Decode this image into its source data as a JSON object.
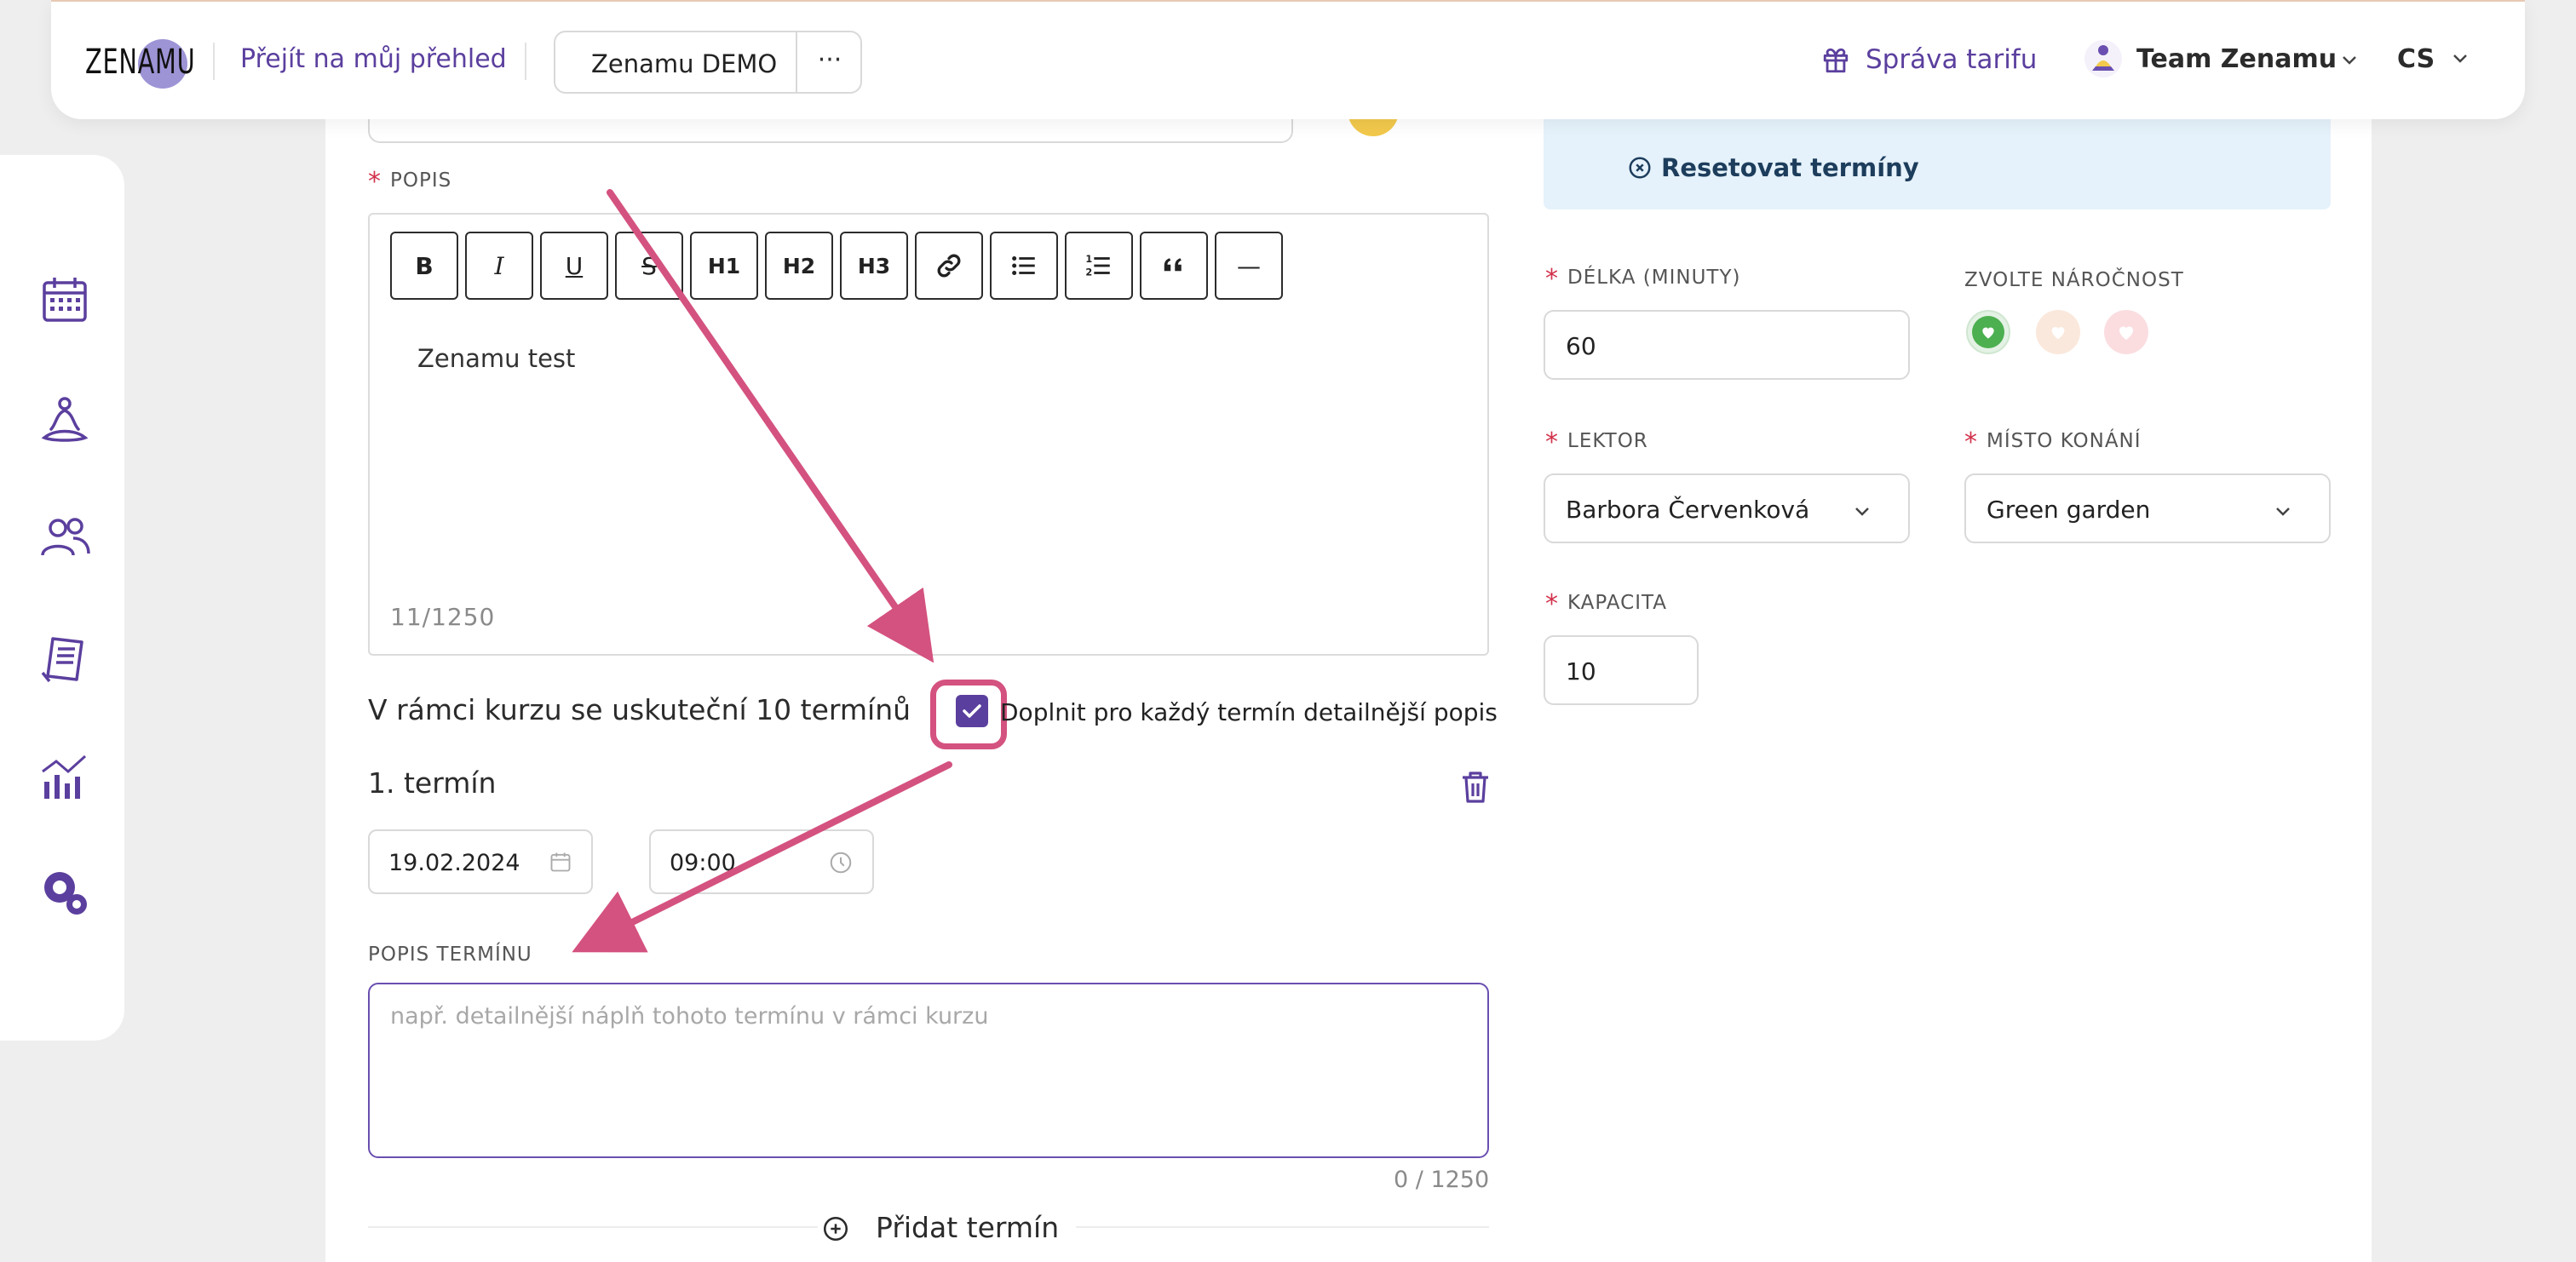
{
  "header": {
    "logo_text": "ZENAMU",
    "overview_link": "Přejít na můj přehled",
    "org_name": "Zenamu DEMO",
    "more_label": "···",
    "tariff_label": "Správa tarifu",
    "team_label": "Team Zenamu",
    "language": "CS"
  },
  "sidebar": {
    "items": [
      {
        "icon": "calendar-icon"
      },
      {
        "icon": "meditation-icon"
      },
      {
        "icon": "users-icon"
      },
      {
        "icon": "invoice-icon"
      },
      {
        "icon": "analytics-icon"
      },
      {
        "icon": "settings-icon"
      }
    ]
  },
  "form": {
    "description_label": "POPIS",
    "toolbar": [
      "B",
      "I",
      "U",
      "S",
      "H1",
      "H2",
      "H3",
      "link",
      "bulleted-list",
      "numbered-list",
      "quote",
      "—"
    ],
    "editor_text": "Zenamu test",
    "editor_count": "11/1250",
    "course_note": "V rámci kurzu se uskuteční 10 termínů",
    "detail_checkbox_label": "Doplnit pro každý termín detailnější popis",
    "detail_checkbox_checked": true,
    "term_title": "1. termín",
    "term_date": "19.02.2024",
    "term_time": "09:00",
    "term_desc_label": "POPIS TERMÍNU",
    "term_desc_placeholder": "např. detailnější náplň tohoto termínu v rámci kurzu",
    "term_desc_count": "0 / 1250",
    "add_term_label": "Přidat termín"
  },
  "right": {
    "reset_label": "Resetovat termíny",
    "duration_label": "DÉLKA (MINUTY)",
    "duration_value": "60",
    "difficulty_label": "ZVOLTE NÁROČNOST",
    "lector_label": "LEKTOR",
    "lector_value": "Barbora Červenková",
    "place_label": "MÍSTO KONÁNÍ",
    "place_value": "Green garden",
    "capacity_label": "KAPACITA",
    "capacity_value": "10"
  },
  "colors": {
    "brand_purple": "#5b3f9e",
    "annotation_pink": "#d4527f",
    "required_red": "#d2314b",
    "info_blue": "#e5f2fb",
    "difficulty_easy": "#4caf50"
  }
}
